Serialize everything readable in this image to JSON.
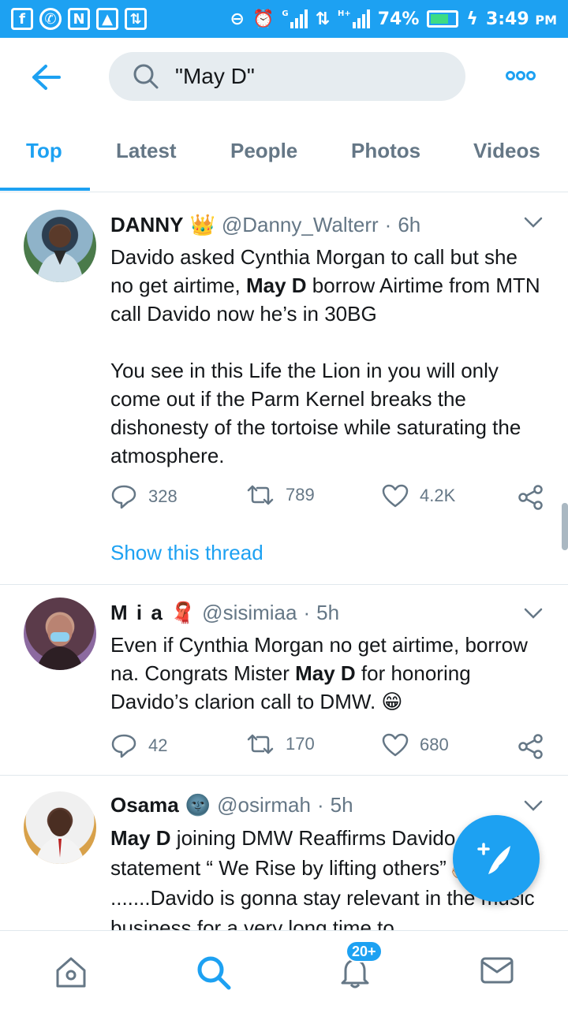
{
  "status_bar": {
    "battery": "74%",
    "time": "3:49",
    "ampm": "PM",
    "battery_level": 0.74,
    "left_icons": [
      "facebook-icon",
      "whatsapp-icon",
      "n-app-icon",
      "gallery-icon",
      "data-transfer-icon"
    ],
    "right_icons": [
      "do-not-disturb-icon",
      "alarm-icon",
      "signal-icon",
      "data-arrows-icon",
      "signal-hplus-icon",
      "battery-icon",
      "charging-icon"
    ],
    "signal_g": "G",
    "signal_hplus": "H+"
  },
  "search": {
    "query": "\"May D\""
  },
  "tabs": [
    {
      "label": "Top",
      "active": true
    },
    {
      "label": "Latest",
      "active": false
    },
    {
      "label": "People",
      "active": false
    },
    {
      "label": "Photos",
      "active": false
    },
    {
      "label": "Videos",
      "active": false
    }
  ],
  "tweets": [
    {
      "name": "DANNY",
      "name_emoji": "👑",
      "handle": "@Danny_Walterr",
      "separator": "·",
      "time": "6h",
      "text_1a": "Davido asked Cynthia Morgan to call but she no get airtime, ",
      "text_1b": "May D",
      "text_1c": " borrow Airtime from MTN call Davido now he’s in 30BG",
      "text_2": "You see in this Life the Lion in you will only come out if the Parm Kernel breaks the dishonesty of the tortoise while saturating the atmosphere.",
      "replies": "328",
      "retweets": "789",
      "likes": "4.2K",
      "thread_link": "Show this thread"
    },
    {
      "name": "M i a",
      "name_emoji": "🧣",
      "handle": "@sisimiaa",
      "separator": "·",
      "time": "5h",
      "text_a": "Even if Cynthia Morgan no get airtime, borrow na. Congrats Mister ",
      "text_b": "May D",
      "text_c": " for honoring Davido’s clarion call to DMW. ",
      "text_emoji": "😁",
      "replies": "42",
      "retweets": "170",
      "likes": "680"
    },
    {
      "name": "Osama",
      "name_emoji": "🌚",
      "handle": "@osirmah",
      "separator": "·",
      "time": "5h",
      "text_a": "May D",
      "text_b": " joining DMW Reaffirms Davido famous statement “ We Rise by lifting others”",
      "text_emoji": "👌🏻",
      "text_c": " .......Davido is gonna stay relevant in the music business for a very long time to"
    }
  ],
  "nav": {
    "badge": "20+",
    "items": [
      "home-icon",
      "search-icon",
      "notifications-icon",
      "messages-icon"
    ]
  },
  "colors": {
    "accent": "#1da1f2",
    "muted": "#657786",
    "text": "#14171a",
    "divider": "#e1e8ed"
  }
}
